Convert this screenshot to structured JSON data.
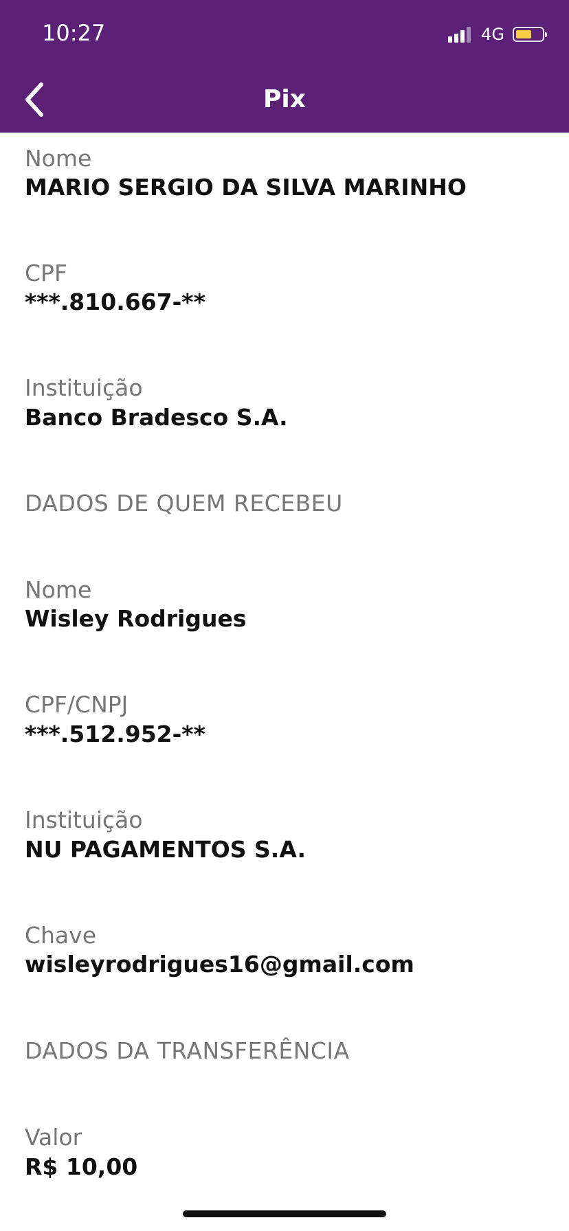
{
  "status_bar": {
    "time": "10:27",
    "network": "4G",
    "battery_color": "#f7cf46"
  },
  "header": {
    "title": "Pix",
    "background_color": "#5b2177",
    "back_icon": "chevron-left-icon"
  },
  "payer": {
    "name_label": "Nome",
    "name_value": "MARIO SERGIO DA SILVA MARINHO",
    "cpf_label": "CPF",
    "cpf_value": "***.810.667-**",
    "institution_label": "Instituição",
    "institution_value": "Banco Bradesco S.A."
  },
  "receiver": {
    "section_title": "DADOS DE QUEM RECEBEU",
    "name_label": "Nome",
    "name_value": "Wisley Rodrigues",
    "doc_label": "CPF/CNPJ",
    "doc_value": "***.512.952-**",
    "institution_label": "Instituição",
    "institution_value": "NU PAGAMENTOS S.A.",
    "key_label": "Chave",
    "key_value": "wisleyrodrigues16@gmail.com"
  },
  "transfer": {
    "section_title": "DADOS DA TRANSFERÊNCIA",
    "amount_label": "Valor",
    "amount_value": "R$ 10,00"
  }
}
